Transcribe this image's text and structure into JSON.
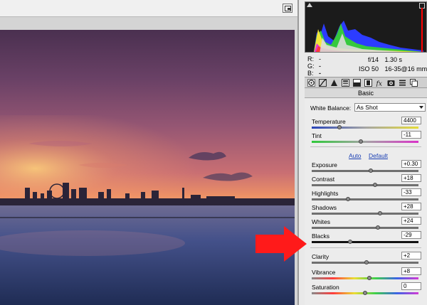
{
  "readout": {
    "r_label": "R:",
    "g_label": "G:",
    "b_label": "B:",
    "r_value": "---",
    "g_value": "---",
    "b_value": "---",
    "aperture": "f/14",
    "shutter": "1.30 s",
    "iso": "ISO 50",
    "lens": "16-35@16 mm"
  },
  "panel": {
    "section_title": "Basic"
  },
  "white_balance": {
    "label": "White Balance:",
    "value": "As Shot"
  },
  "auto_label": "Auto",
  "default_label": "Default",
  "sliders": [
    {
      "id": "temperature",
      "label": "Temperature",
      "value": "4400",
      "fraction": 0.26
    },
    {
      "id": "tint",
      "label": "Tint",
      "value": "-11",
      "fraction": 0.46
    },
    {
      "id": "exposure",
      "label": "Exposure",
      "value": "+0.30",
      "fraction": 0.55
    },
    {
      "id": "contrast",
      "label": "Contrast",
      "value": "+18",
      "fraction": 0.59
    },
    {
      "id": "highlights",
      "label": "Highlights",
      "value": "-33",
      "fraction": 0.34
    },
    {
      "id": "shadows",
      "label": "Shadows",
      "value": "+28",
      "fraction": 0.64
    },
    {
      "id": "whites",
      "label": "Whites",
      "value": "+24",
      "fraction": 0.62
    },
    {
      "id": "blacks",
      "label": "Blacks",
      "value": "-29",
      "fraction": 0.36
    },
    {
      "id": "clarity",
      "label": "Clarity",
      "value": "+2",
      "fraction": 0.51
    },
    {
      "id": "vibrance",
      "label": "Vibrance",
      "value": "+8",
      "fraction": 0.54
    },
    {
      "id": "saturation",
      "label": "Saturation",
      "value": "0",
      "fraction": 0.5
    }
  ],
  "icons": {
    "fullscreen": "fullscreen-icon",
    "arrow": "red-arrow-pointer",
    "tabs": [
      "basic-icon",
      "tone-curve-icon",
      "detail-icon",
      "hsl-icon",
      "split-toning-icon",
      "lens-corrections-icon",
      "effects-icon",
      "camera-calibration-icon",
      "presets-icon",
      "snapshots-icon"
    ]
  },
  "colors": {
    "arrow": "#ff1a1a",
    "highlight_clip": "#ff0000"
  }
}
